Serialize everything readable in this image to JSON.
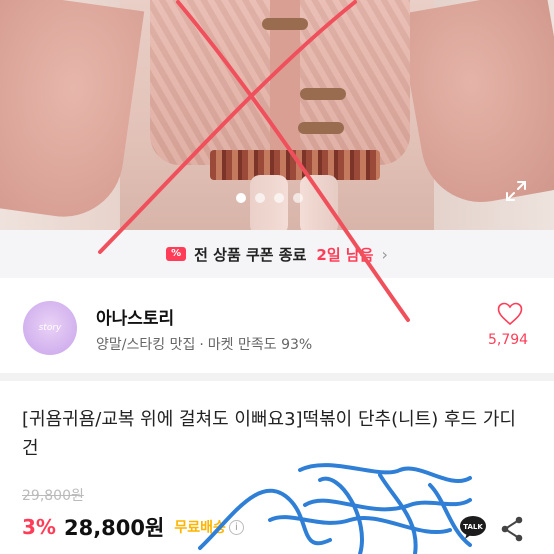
{
  "gallery": {
    "image_count": 4,
    "active_index": 1,
    "expand_icon": "expand-icon"
  },
  "coupon_banner": {
    "icon": "coupon-percent-icon",
    "icon_text": "%",
    "text": "전 상품 쿠폰 종료",
    "remaining": "2일 남음",
    "chevron": "›"
  },
  "store": {
    "name": "아나스토리",
    "category": "양말/스타킹 맛집",
    "separator": "·",
    "satisfaction": "마켓 만족도 93%",
    "likes": "5,794",
    "heart_icon": "heart-icon"
  },
  "product": {
    "title": "[귀욤귀욤/교복 위에 걸쳐도 이뻐요3]떡볶이 단추(니트) 후드 가디건",
    "original_price": "29,800원",
    "discount": "3%",
    "price": "28,800원",
    "shipping": "무료배송",
    "info_icon_text": "i"
  },
  "actions": {
    "talk_label": "TALK",
    "share_icon": "share-icon"
  },
  "colors": {
    "accent": "#ff3d58",
    "shipping": "#ffb400",
    "x_mark": "#f0505c",
    "scribble": "#2f7fd6"
  }
}
